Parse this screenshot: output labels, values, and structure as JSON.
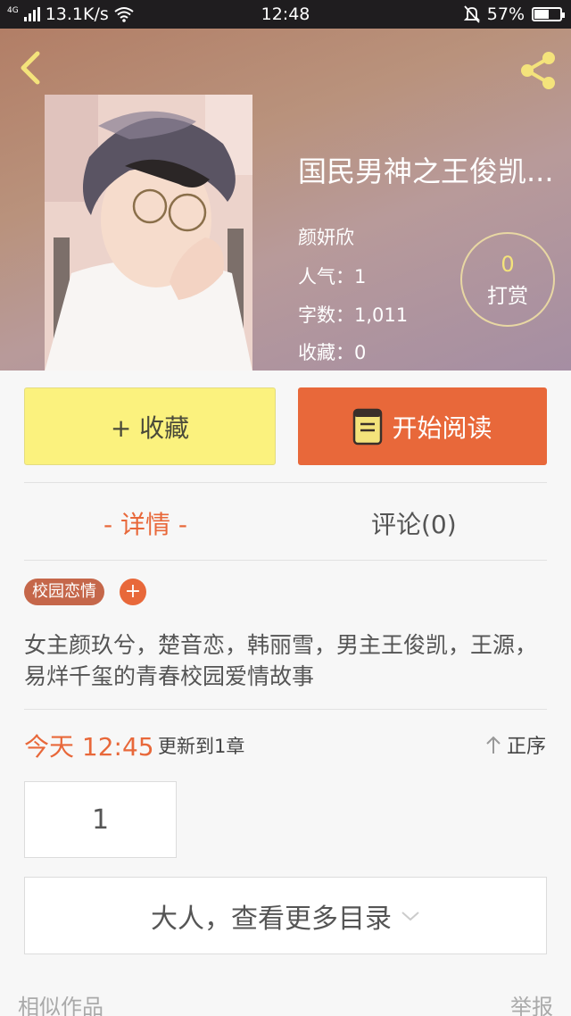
{
  "status_bar": {
    "network": "4G",
    "speed": "13.1K/s",
    "time": "12:48",
    "battery": "57%",
    "battery_level": 0.57
  },
  "book": {
    "title": "国民男神之王俊凯...",
    "author": "颜妍欣",
    "popularity": "人气：1",
    "word_count": "字数：1,011",
    "favorites": "收藏：0"
  },
  "tip": {
    "count": "0",
    "label": "打赏"
  },
  "actions": {
    "favorite_label": "+ 收藏",
    "read_label": "开始阅读"
  },
  "tabs": {
    "detail": "- 详情 -",
    "comments": "评论(0)"
  },
  "tag": {
    "label": "校园恋情",
    "add": "+"
  },
  "description": "女主颜玖兮，楚音恋，韩丽雪，男主王俊凯，王源，易烊千玺的青春校园爱情故事",
  "update": {
    "time": "今天 12:45",
    "text": "更新到1章",
    "sort_label": "正序"
  },
  "chapter": {
    "number": "1"
  },
  "more_catalog": "大人，查看更多目录",
  "footer": {
    "similar": "相似作品",
    "report": "举报"
  },
  "colors": {
    "accent": "#e8683a",
    "favorite_bg": "#fbf27e",
    "icon_yellow": "#f4e37b",
    "tag_bg": "#c5674a"
  }
}
